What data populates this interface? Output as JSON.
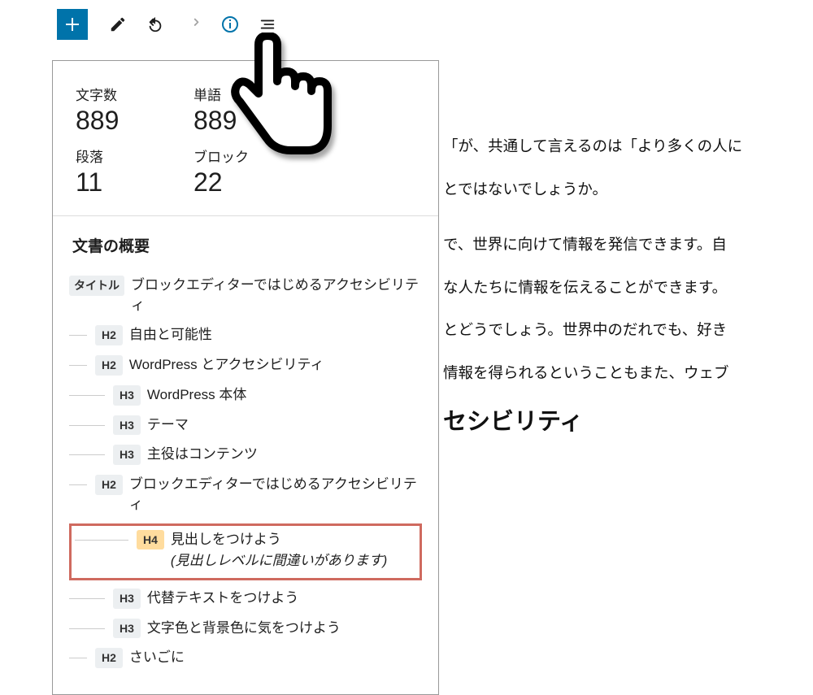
{
  "toolbar": {
    "add": "+",
    "tools": "tools",
    "undo": "undo",
    "redo": "redo",
    "info": "info",
    "outline": "outline"
  },
  "stats": {
    "chars_label": "文字数",
    "chars_value": "889",
    "words_label": "単語",
    "words_value": "889",
    "paragraphs_label": "段落",
    "paragraphs_value": "11",
    "blocks_label": "ブロック",
    "blocks_value": "22"
  },
  "outline": {
    "title": "文書の概要",
    "title_tag": "タイトル",
    "warning_text": "(見出しレベルに間違いがあります)",
    "items": [
      {
        "level": "title",
        "tag": "タイトル",
        "text": "ブロックエディターではじめるアクセシビリティ",
        "warn": false
      },
      {
        "level": "h2",
        "tag": "H2",
        "text": "自由と可能性",
        "warn": false
      },
      {
        "level": "h2",
        "tag": "H2",
        "text": "WordPress とアクセシビリティ",
        "warn": false
      },
      {
        "level": "h3",
        "tag": "H3",
        "text": "WordPress 本体",
        "warn": false
      },
      {
        "level": "h3",
        "tag": "H3",
        "text": "テーマ",
        "warn": false
      },
      {
        "level": "h3",
        "tag": "H3",
        "text": "主役はコンテンツ",
        "warn": false
      },
      {
        "level": "h2",
        "tag": "H2",
        "text": "ブロックエディターではじめるアクセシビリティ",
        "warn": false
      },
      {
        "level": "h4",
        "tag": "H4",
        "text": "見出しをつけよう",
        "warn": true
      },
      {
        "level": "h3",
        "tag": "H3",
        "text": "代替テキストをつけよう",
        "warn": false
      },
      {
        "level": "h3",
        "tag": "H3",
        "text": "文字色と背景色に気をつけよう",
        "warn": false
      },
      {
        "level": "h2",
        "tag": "H2",
        "text": "さいごに",
        "warn": false
      }
    ]
  },
  "article": {
    "p1": "「が、共通して言えるのは「より多くの人に",
    "p2": "とではないでしょうか。",
    "p3": "で、世界に向けて情報を発信できます。自",
    "p4": "な人たちに情報を伝えることができます。",
    "p5": "とどうでしょう。世界中のだれでも、好き",
    "p6": "情報を得られるということもまた、ウェブ",
    "h2": "セシビリティ"
  }
}
